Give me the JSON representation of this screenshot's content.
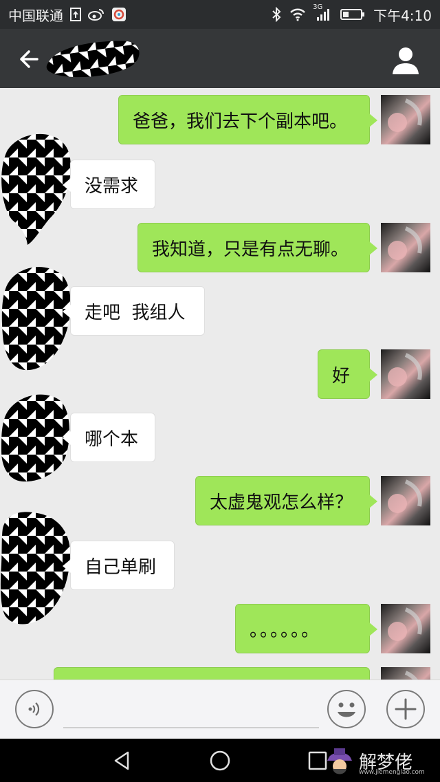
{
  "status_bar": {
    "carrier": "中国联通",
    "network": "3G",
    "time": "下午4:10"
  },
  "header": {
    "contact_name": ""
  },
  "messages": [
    {
      "from": "me",
      "text": "爸爸，我们去下个副本吧。"
    },
    {
      "from": "them",
      "text": "没需求"
    },
    {
      "from": "me",
      "text": "我知道，只是有点无聊。"
    },
    {
      "from": "them",
      "text": "走吧  我组人"
    },
    {
      "from": "me",
      "text": "好"
    },
    {
      "from": "them",
      "text": "哪个本"
    },
    {
      "from": "me",
      "text": "太虚鬼观怎么样？"
    },
    {
      "from": "them",
      "text": "自己单刷"
    },
    {
      "from": "me",
      "text": "。。。。。。"
    },
    {
      "from": "me",
      "text": ""
    }
  ],
  "input_bar": {
    "placeholder": ""
  },
  "watermark": {
    "text": "解梦佬",
    "url": "www.jiemenglao.com"
  },
  "colors": {
    "my_bubble": "#9fe659",
    "their_bubble": "#ffffff",
    "chat_background": "#ebebeb",
    "title_bar": "#353739"
  },
  "icons": {
    "back": "arrow-left-icon",
    "profile": "person-icon",
    "voice": "voice-icon",
    "emoji": "smiley-icon",
    "more": "plus-icon",
    "nav_back": "triangle-back-icon",
    "nav_home": "circle-home-icon",
    "nav_recent": "square-recent-icon"
  }
}
